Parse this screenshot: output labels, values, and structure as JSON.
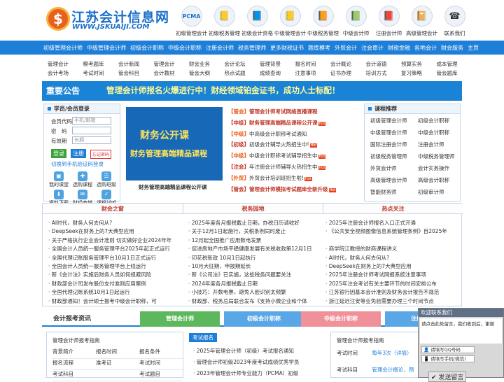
{
  "header": {
    "logo_cn": "江苏会计信息网",
    "logo_en": "WWW.JSKUAIJI.COM",
    "icons": [
      {
        "label": "初级管理会计",
        "icon": "pcma-badge-icon",
        "glyph": "PCMA"
      },
      {
        "label": "初级税务管理",
        "icon": "chart-book-icon",
        "glyph": "📒"
      },
      {
        "label": "初级会计资格",
        "icon": "graduation-book-icon",
        "glyph": "📘"
      },
      {
        "label": "中级管理会计",
        "icon": "chart-book-icon",
        "glyph": "📒"
      },
      {
        "label": "中级税务管理",
        "icon": "graduation-book-icon",
        "glyph": "📙"
      },
      {
        "label": "中级会计师",
        "icon": "chart-book-icon",
        "glyph": "📗"
      },
      {
        "label": "注册会计师",
        "icon": "chart-book-icon",
        "glyph": "📕"
      },
      {
        "label": "高级管理会计",
        "icon": "graduation-book-icon",
        "glyph": "📔"
      },
      {
        "label": "联系我们",
        "icon": "telephone-icon",
        "glyph": "☎"
      }
    ]
  },
  "nav": [
    "初级管理会计师",
    "中级管理会计师",
    "初级会计职称",
    "中级会计职称",
    "注册会计师",
    "税务管理师",
    "更多财税证书",
    "题库模考",
    "外贸会计",
    "注会审计",
    "财税金融",
    "各地会计",
    "财会服务",
    "主页"
  ],
  "subnav": [
    "管理会计",
    "模考题库",
    "会计新闻",
    "管理会计",
    "财会业务",
    "会计论坛",
    "管理背景",
    "报名时间",
    "会计概论",
    "会计道德",
    "预算实务",
    "成本管理",
    "会计考场",
    "考试时间",
    "管会科目",
    "会计教材",
    "管会大纲",
    "热点试题",
    "成绩查询",
    "注意事项",
    "证书办理",
    "培训方式",
    "复习策略",
    "管会题库"
  ],
  "banner": {
    "tag": "重要公告",
    "text": "管理会计师报名火爆进行中！财经领域铂金证书，成功人士标配！"
  },
  "login": {
    "title": "学员/会员登录",
    "rows": [
      {
        "label": "会员代码",
        "placeholder": "手机/邮箱"
      },
      {
        "label": "密　码",
        "placeholder": ""
      },
      {
        "label": "有效期",
        "placeholder": "长期"
      }
    ],
    "login_btn": "登录",
    "register_btn": "注册",
    "forgot_btn": "忘记密码",
    "switch_link": "切换到手机验证码登录",
    "icons": [
      {
        "label": "我的课堂",
        "glyph": "▣"
      },
      {
        "label": "选购课程",
        "glyph": "✚"
      },
      {
        "label": "选购班级",
        "glyph": "☰"
      },
      {
        "label": "资料下载",
        "glyph": "⬇"
      },
      {
        "label": "财经商城",
        "glyph": "✉"
      },
      {
        "label": "课程试听",
        "glyph": "✓"
      }
    ]
  },
  "promo": {
    "line1": "财务公开课",
    "line2": "财务管理高端精品课程",
    "caption": "财务管理高端精品课程公开课"
  },
  "news": [
    {
      "tag": "【管会】",
      "text": "管理会计师考试网络直播课程",
      "bold": true,
      "hot": false
    },
    {
      "tag": "【中级】",
      "text": "财务管理高端精品课程公开课",
      "bold": true,
      "hot": true
    },
    {
      "tag": "【中级】",
      "text": "中高级会计职称考试通知",
      "bold": false,
      "hot": false
    },
    {
      "tag": "【初级】",
      "text": "初级会计辅导火热招生中!",
      "bold": false,
      "hot": true
    },
    {
      "tag": "【中级】",
      "text": "中级会计职称考试辅导招生中",
      "bold": false,
      "hot": true
    },
    {
      "tag": "【注会】",
      "text": "年注册会计师辅导火热招生中",
      "bold": false,
      "hot": true
    },
    {
      "tag": "【外贸】",
      "text": "外贸会计培训班招生啦!",
      "bold": false,
      "hot": true
    },
    {
      "tag": "【管会】",
      "text": "管理会计师模拟考试题库全新升级",
      "bold": true,
      "hot": true
    }
  ],
  "hot_label": "Hot",
  "courses": {
    "title": "课程推荐",
    "items": [
      "初级管理会计师",
      "初级会计职称",
      "中级管理会计师",
      "中级会计职称",
      "国际注册会计师",
      "注册会计师",
      "初级税务管理师",
      "中级税务管理师",
      "外贸会计师",
      "会计实务操作",
      "高级管理会计师",
      "高级会计职称",
      "智能财务师",
      "初级审计师"
    ]
  },
  "columns": [
    {
      "title": "财会之窗",
      "items": [
        "AI时代，财务人何去何从?",
        "DeepSeek在财务上的7大典型应用",
        "关于严格执行企业会计准则 切实做好企业2024年年",
        "全国会计人员统一服务管理平台2025年起正式运行",
        "全国代理记账服务管理平台10月1日正式运行",
        "全国会计人员统一服务管理平台上线运行",
        "新《会计法》实施后财务人员如何规避风险",
        "财政部会计司发布股份支付准则应用案例",
        "全国代理记账系统10月1日起运行",
        "财政部通知！会计硕士报考中级会计职称，可"
      ]
    },
    {
      "title": "税务园地",
      "items": [
        "2025年度各月报税截止日期，办税日历请收好",
        "关于12月1日起施行，关税条例同时废止",
        "12月起全国推广应用数电发票",
        "促进房地产市场平稳健康发展有关税收政策12月1日",
        "印花税新政 10月1日起执行",
        "10月大征期，申报期延长",
        "新《公司法》已实施，这些税务问题要关注",
        "2024年度各月报税截止日期",
        "小技巧：开数电票，避免人脸识别太频繁",
        "财政部、税务总局联合发布《支持小微企业和个体"
      ]
    },
    {
      "title": "热点关注",
      "items": [
        "2025年注册会计师报名入口正式开通",
        "《公共安全视频图像信息系统管理条例》自2025年",
        "",
        "商学院江教授的财商课程讲义",
        "AI时代，财务人何去何从?",
        "DeepSeek在财务上的7大典型应用",
        "2025年注册会计师考试网报系统注意事项",
        "2025年注会考试有关主要环节的时间安排公布",
        "江苏银行因基本会计准则及财务会计报告不规范",
        "浙江延迟注安等业免验需要办理三个时间节点"
      ]
    }
  ],
  "exam": {
    "title": "会计报考资讯",
    "tabs": [
      "管理会计师",
      "初级会计职称",
      "中级会计职称",
      "注册会计师"
    ]
  },
  "bottom_left": {
    "title": "管理会计师报考指南",
    "cells": [
      "背景简介",
      "报名时间",
      "报名条件",
      "报名流程",
      "准考证",
      "考试时间",
      "考试科目",
      "",
      "考试题目"
    ]
  },
  "bottom_mid": {
    "tag": "考试报名",
    "items": [
      "2025年管理会计师（初级）考试报名通知",
      "管理会计师初级2023年度考试成绩优秀学员",
      "2023年管理会计师专业能力（PCMA）初级"
    ]
  },
  "bottom_right": {
    "title": "管理会计师报考指南",
    "rows": [
      {
        "label": "考试时间",
        "value": "每年3次（详情）"
      },
      {
        "label": "考试科目",
        "value": "管理会计概论、预"
      }
    ]
  },
  "chat": {
    "title": "欢迎联系我们",
    "body": "请点击此处留言，我们收到后，谢谢",
    "btn_qq": "请填写QQ号码",
    "btn_phone": "请填写手机(微信)",
    "send": "发送留言"
  },
  "colors": {
    "nav_blue": "#1e7fd8",
    "banner_yellow": "#fffb96",
    "tag_orange": "#e8611c",
    "tab_green": "#5db85d",
    "tab_blue": "#5aa7e8",
    "tab_pink": "#f0919a"
  }
}
